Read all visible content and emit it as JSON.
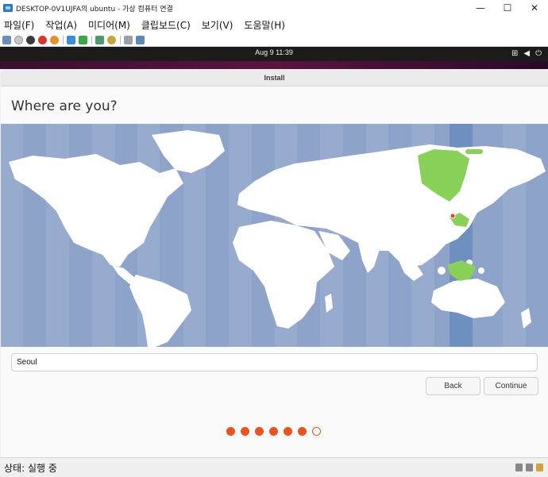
{
  "window": {
    "title": "DESKTOP-0V1UJFA의 ubuntu - 가상 컴퓨터 연결",
    "controls": {
      "minimize": "—",
      "maximize": "☐",
      "close": "✕"
    }
  },
  "menu": {
    "items": [
      "파일(F)",
      "작업(A)",
      "미디어(M)",
      "클립보드(C)",
      "보기(V)",
      "도움말(H)"
    ]
  },
  "toolbar": {
    "icons": [
      "ctrl-alt-del-icon",
      "start-icon",
      "turn-off-icon",
      "shutdown-icon",
      "save-icon",
      "pause-icon",
      "resume-icon",
      "checkpoint-icon",
      "revert-icon",
      "enhanced-session-icon",
      "share-icon"
    ]
  },
  "ubuntu": {
    "clock": "Aug 9  11:39",
    "tray": [
      "network-icon",
      "volume-icon",
      "power-icon"
    ]
  },
  "installer": {
    "header": "Install",
    "heading": "Where are you?",
    "timezone_value": "Seoul",
    "back_label": "Back",
    "continue_label": "Continue",
    "progress": {
      "total": 7,
      "completed": 6
    }
  },
  "statusbar": {
    "status": "상태: 실행 중"
  },
  "colors": {
    "accent": "#e95420",
    "map_ocean": "#8ea3c9",
    "selected_zone": "#6f8fc0",
    "highlight_land": "#89d159"
  }
}
